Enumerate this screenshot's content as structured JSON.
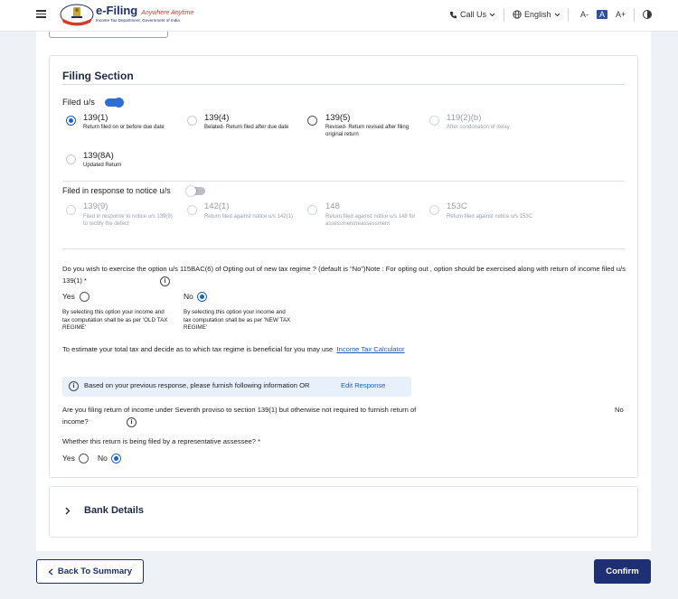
{
  "header": {
    "logo_title": "e-Filing",
    "logo_tagline": "Anywhere Anytime",
    "logo_subtitle": "Income Tax Department, Government of India",
    "call_us": "Call Us",
    "language": "English",
    "font_decrease": "A-",
    "font_normal": "A",
    "font_increase": "A+"
  },
  "filing_section": {
    "title": "Filing Section",
    "filed_us_label": "Filed u/s",
    "filed_us_toggle": "on",
    "options": [
      {
        "code": "139(1)",
        "desc": "Return filed on or before due date",
        "state": "checked"
      },
      {
        "code": "139(4)",
        "desc": "Belated- Return filed after due date",
        "state": "unchecked"
      },
      {
        "code": "139(5)",
        "desc": "Revised- Return revised after filing original return",
        "state": "unchecked"
      },
      {
        "code": "119(2)(b)",
        "desc": "After condonation of delay",
        "state": "disabled"
      },
      {
        "code": "139(8A)",
        "desc": "Updated Return",
        "state": "unchecked"
      }
    ],
    "notice_label": "Filed in response to notice u/s",
    "notice_toggle": "off",
    "notice_options": [
      {
        "code": "139(9)",
        "desc": "Filed in response to notice u/s 139(9) to rectify the defect"
      },
      {
        "code": "142(1)",
        "desc": "Return filed against notice u/s 142(1)"
      },
      {
        "code": "148",
        "desc": "Return filed against notice u/s 148 for assessment/reassessment"
      },
      {
        "code": "153C",
        "desc": "Return filed against notice u/s 153C"
      }
    ],
    "regime_question": "Do you wish to exercise the option u/s 115BAC(6) of Opting out of new tax regime ? (default is “No”)Note : For opting out , option should be exercised along with return of income filed u/s 139(1) *",
    "regime_yes_label": "Yes",
    "regime_no_label": "No",
    "regime_selected": "No",
    "regime_yes_desc": "By selecting this option your income and tax computation shall be as per 'OLD TAX REGIME'",
    "regime_no_desc": "By selecting this option your income and tax computation shall be as per 'NEW TAX REGIME'",
    "estimate_text": "To estimate your total tax and decide as to which tax regime is beneficial for you may use",
    "calculator_link": "Income Tax Calculator",
    "banner_text": "Based on your previous response, please furnish following information OR",
    "edit_response": "Edit Response",
    "seventh_proviso_question": "Are you filing return of income under Seventh proviso to section 139(1) but otherwise not required to furnish return of income?",
    "seventh_proviso_answer": "No",
    "representative_question": "Whether this return is being filed by a representative assessee? *",
    "rep_yes_label": "Yes",
    "rep_no_label": "No",
    "rep_selected": "No"
  },
  "bank_details": {
    "title": "Bank Details"
  },
  "footer": {
    "back_label": "Back To Summary",
    "confirm_label": "Confirm"
  },
  "colors": {
    "primary": "#1f2f73",
    "link": "#1b5fc4",
    "banner_bg": "#e8f1fb"
  }
}
